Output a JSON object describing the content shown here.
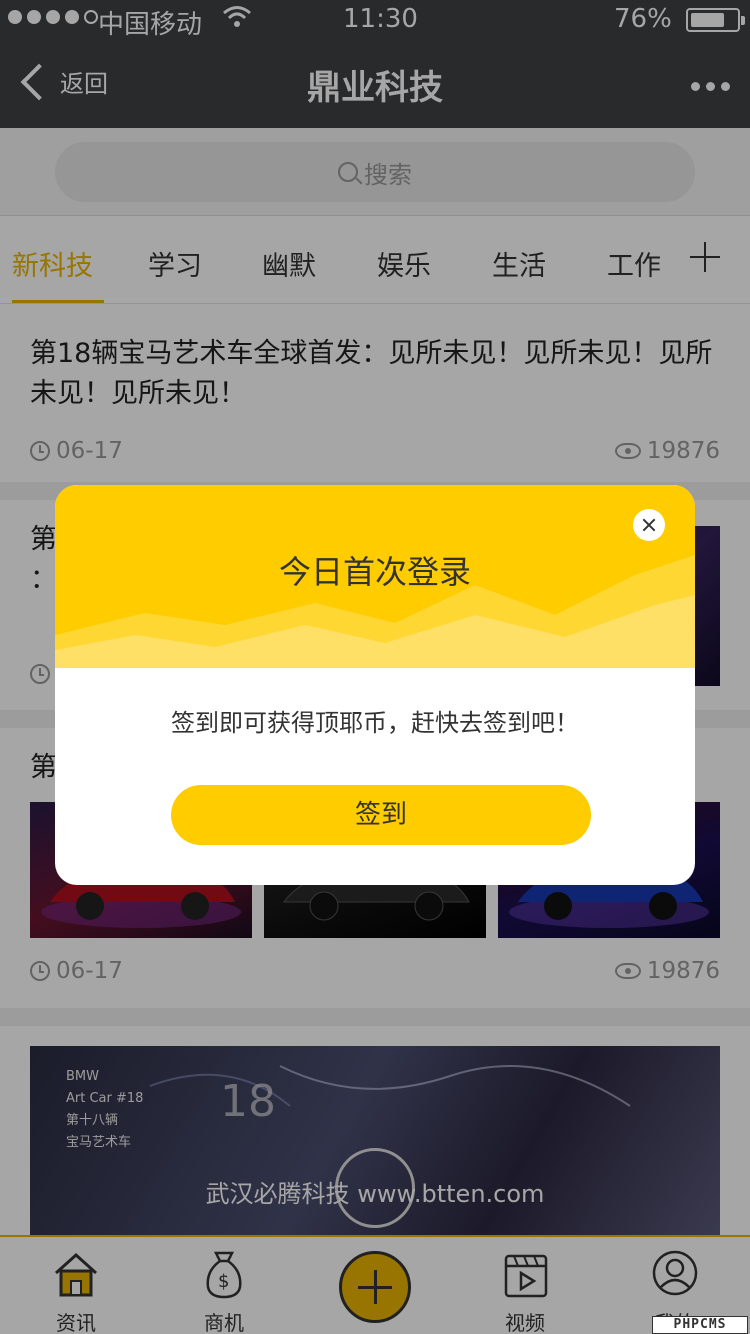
{
  "status_bar": {
    "carrier": "中国移动",
    "time": "11:30",
    "battery": "76%",
    "battery_level": 0.76,
    "signal_bars": 4
  },
  "nav": {
    "back_label": "返回",
    "title": "鼎业科技"
  },
  "search": {
    "placeholder": "搜索"
  },
  "tabs": [
    {
      "label": "新科技",
      "active": true
    },
    {
      "label": "学习"
    },
    {
      "label": "幽默"
    },
    {
      "label": "娱乐"
    },
    {
      "label": "生活"
    },
    {
      "label": "工作"
    }
  ],
  "articles": [
    {
      "title": "第18辆宝马艺术车全球首发：见所未见！见所未见！见所未见！见所未见！",
      "date": "06-17",
      "views": "19876"
    },
    {
      "title_partial": "第",
      "title_partial2": "："
    },
    {
      "title_partial": "第",
      "date": "06-17",
      "views": "19876"
    },
    {
      "video_caption": "武汉必腾科技 www.btten.com",
      "image_text": [
        "BMW",
        "Art Car #18",
        "第十八辆",
        "宝马艺术车"
      ]
    }
  ],
  "tab_bar": [
    {
      "label": "资讯",
      "icon": "home-icon"
    },
    {
      "label": "商机",
      "icon": "money-bag-icon"
    },
    {
      "label": "",
      "icon": "plus-icon"
    },
    {
      "label": "视频",
      "icon": "video-icon"
    },
    {
      "label": "我的",
      "icon": "user-icon"
    }
  ],
  "modal": {
    "title": "今日首次登录",
    "message": "签到即可获得顶耶币，赶快去签到吧！",
    "button": "签到"
  },
  "watermark": "PHPCMS",
  "colors": {
    "accent": "#ffcc00",
    "nav": "#3f4144"
  }
}
